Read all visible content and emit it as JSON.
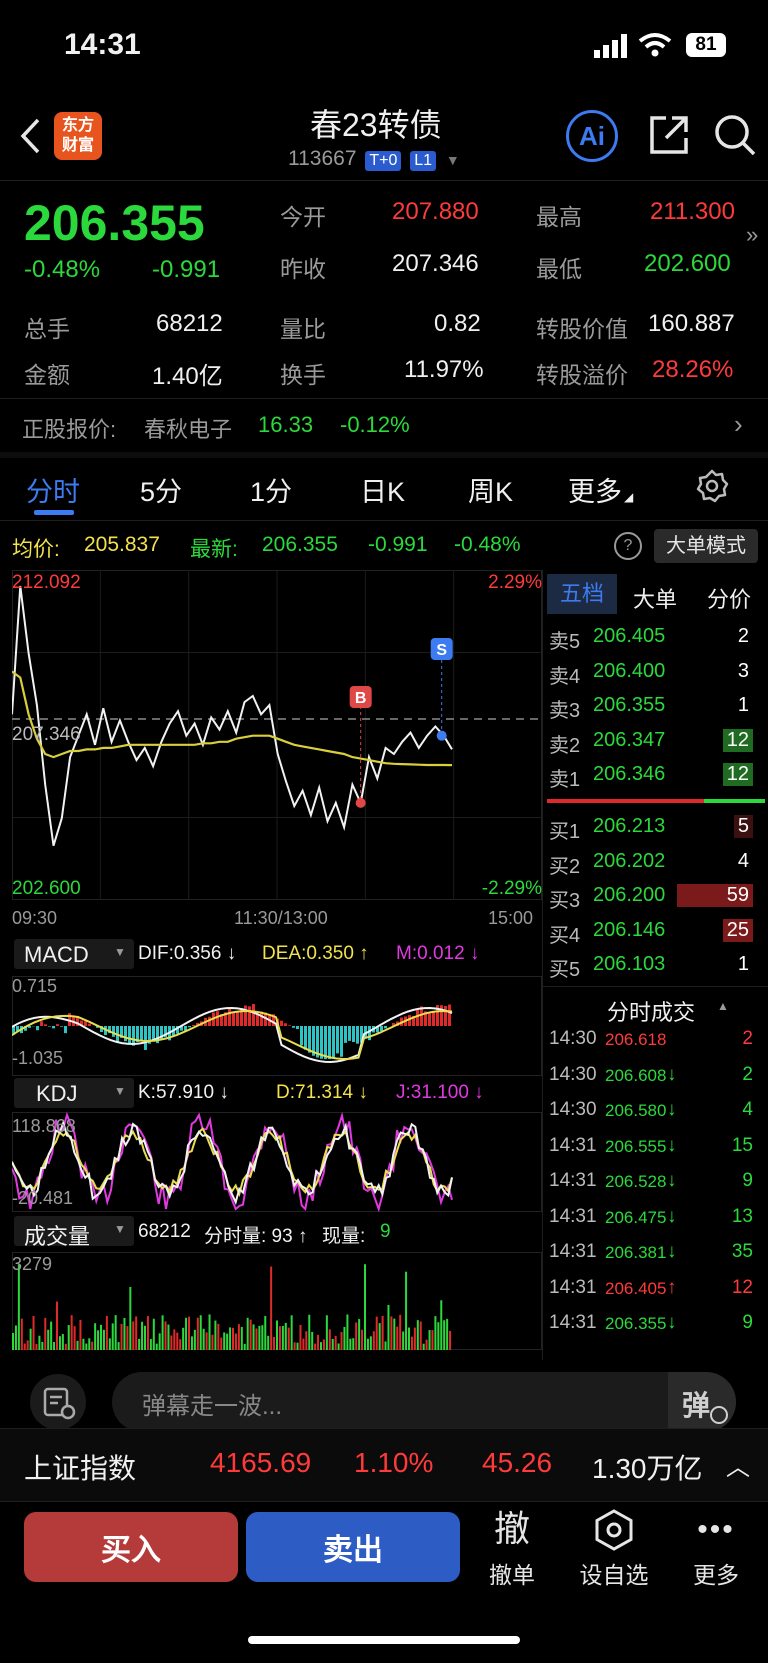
{
  "status_bar": {
    "time": "14:31",
    "battery": "81"
  },
  "header": {
    "logo_line1": "东方",
    "logo_line2": "财富",
    "title": "春23转债",
    "code": "113667",
    "tag1": "T+0",
    "tag2": "L1",
    "ai_label": "Ai"
  },
  "quote": {
    "price": "206.355",
    "change_pct": "-0.48%",
    "change": "-0.991",
    "open_label": "今开",
    "open": "207.880",
    "high_label": "最高",
    "high": "211.300",
    "prev_label": "昨收",
    "prev": "207.346",
    "low_label": "最低",
    "low": "202.600",
    "vol_label": "总手",
    "vol": "68212",
    "ratio_label": "量比",
    "ratio": "0.82",
    "conv_value_label": "转股价值",
    "conv_value": "160.887",
    "amount_label": "金额",
    "amount": "1.40亿",
    "turnover_label": "换手",
    "turnover": "11.97%",
    "premium_label": "转股溢价",
    "premium": "28.26%"
  },
  "underlying": {
    "label": "正股报价:",
    "name": "春秋电子",
    "price": "16.33",
    "change": "-0.12%"
  },
  "tabs": [
    "分时",
    "5分",
    "1分",
    "日K",
    "周K",
    "更多"
  ],
  "chart_header": {
    "avg_label": "均价:",
    "avg": "205.837",
    "latest_label": "最新:",
    "latest": "206.355",
    "chg": "-0.991",
    "pct": "-0.48%",
    "help": "?",
    "mode_btn": "大单模式"
  },
  "chart_data": {
    "type": "line",
    "y_top": "212.092",
    "y_mid": "207.346",
    "y_bottom": "202.600",
    "pct_top": "2.29%",
    "pct_bottom": "-2.29%",
    "x_labels": [
      "09:30",
      "11:30/13:00",
      "15:00"
    ],
    "ylim": [
      202.6,
      212.092
    ],
    "reference_price": 207.346,
    "series": [
      {
        "values": [
          207.5,
          211.7,
          209.5,
          207.8,
          205.2,
          203.2,
          204.1,
          206.1,
          206.8,
          207.5,
          206.5,
          207.7,
          206.6,
          207.3,
          206.6,
          206.0,
          206.4,
          205.8,
          206.6,
          207.2,
          207.6,
          206.8,
          207.2,
          206.5,
          207.4,
          207.0,
          207.6,
          206.9,
          207.9,
          208.1,
          207.5,
          207.8,
          206.2,
          205.3,
          204.5,
          205.0,
          204.2,
          205.1,
          204.0,
          204.6,
          203.8,
          205.2,
          204.6,
          206.1,
          205.4,
          206.4,
          206.2,
          206.6,
          206.9,
          206.4,
          206.8,
          207.1,
          206.8,
          206.355
        ]
      },
      {
        "values": [
          208.9,
          208.7,
          207.5,
          206.7,
          206.2,
          206.1,
          206.2,
          206.3,
          206.3,
          206.35,
          206.35,
          206.4,
          206.4,
          206.45,
          206.5,
          206.5,
          206.5,
          206.5,
          206.5,
          206.5,
          206.5,
          206.5,
          206.5,
          206.55,
          206.55,
          206.6,
          206.6,
          206.7,
          206.75,
          206.8,
          206.8,
          206.8,
          206.7,
          206.6,
          206.5,
          206.45,
          206.4,
          206.35,
          206.3,
          206.25,
          206.2,
          206.1,
          206.05,
          206.0,
          205.95,
          205.9,
          205.88,
          205.87,
          205.86,
          205.85,
          205.84,
          205.84,
          205.84,
          205.837
        ]
      }
    ],
    "markers": [
      "B",
      "S"
    ]
  },
  "orderbook": {
    "tabs": [
      "五档",
      "大单",
      "分价"
    ],
    "sells": [
      {
        "label": "卖5",
        "price": "206.405",
        "qty": "2"
      },
      {
        "label": "卖4",
        "price": "206.400",
        "qty": "3"
      },
      {
        "label": "卖3",
        "price": "206.355",
        "qty": "1"
      },
      {
        "label": "卖2",
        "price": "206.347",
        "qty": "12"
      },
      {
        "label": "卖1",
        "price": "206.346",
        "qty": "12"
      }
    ],
    "buys": [
      {
        "label": "买1",
        "price": "206.213",
        "qty": "5"
      },
      {
        "label": "买2",
        "price": "206.202",
        "qty": "4"
      },
      {
        "label": "买3",
        "price": "206.200",
        "qty": "59"
      },
      {
        "label": "买4",
        "price": "206.146",
        "qty": "25"
      },
      {
        "label": "买5",
        "price": "206.103",
        "qty": "1"
      }
    ]
  },
  "ticks": {
    "title": "分时成交",
    "rows": [
      {
        "time": "14:30",
        "price": "206.618",
        "arrow": "",
        "qty": "2",
        "color": "red"
      },
      {
        "time": "14:30",
        "price": "206.608",
        "arrow": "↓",
        "qty": "2",
        "color": "green"
      },
      {
        "time": "14:30",
        "price": "206.580",
        "arrow": "↓",
        "qty": "4",
        "color": "green"
      },
      {
        "time": "14:31",
        "price": "206.555",
        "arrow": "↓",
        "qty": "15",
        "color": "green"
      },
      {
        "time": "14:31",
        "price": "206.528",
        "arrow": "↓",
        "qty": "9",
        "color": "green"
      },
      {
        "time": "14:31",
        "price": "206.475",
        "arrow": "↓",
        "qty": "13",
        "color": "green"
      },
      {
        "time": "14:31",
        "price": "206.381",
        "arrow": "↓",
        "qty": "35",
        "color": "green"
      },
      {
        "time": "14:31",
        "price": "206.405",
        "arrow": "↑",
        "qty": "12",
        "color": "red"
      },
      {
        "time": "14:31",
        "price": "206.355",
        "arrow": "↓",
        "qty": "9",
        "color": "green"
      }
    ]
  },
  "macd": {
    "name": "MACD",
    "dif": "DIF:0.356 ↓",
    "dea": "DEA:0.350 ↑",
    "m": "M:0.012 ↓",
    "top": "0.715",
    "bottom": "-1.035"
  },
  "kdj": {
    "name": "KDJ",
    "k": "K:57.910 ↓",
    "d": "D:71.314 ↓",
    "j": "J:31.100 ↓",
    "top": "118.868",
    "bottom": "-20.481"
  },
  "volume": {
    "name": "成交量",
    "total": "68212",
    "minute": "分时量: 93 ↑",
    "current_label": "现量:",
    "current": "9",
    "top": "3279"
  },
  "danmu": {
    "placeholder": "弹幕走一波...",
    "btn": "弹"
  },
  "index_bar": {
    "name": "上证指数",
    "value": "4165.69",
    "pct": "1.10%",
    "chg": "45.26",
    "amount": "1.30万亿"
  },
  "bottom": {
    "buy": "买入",
    "sell": "卖出",
    "cancel_glyph": "撤",
    "cancel": "撤单",
    "watch": "设自选",
    "more": "更多"
  }
}
